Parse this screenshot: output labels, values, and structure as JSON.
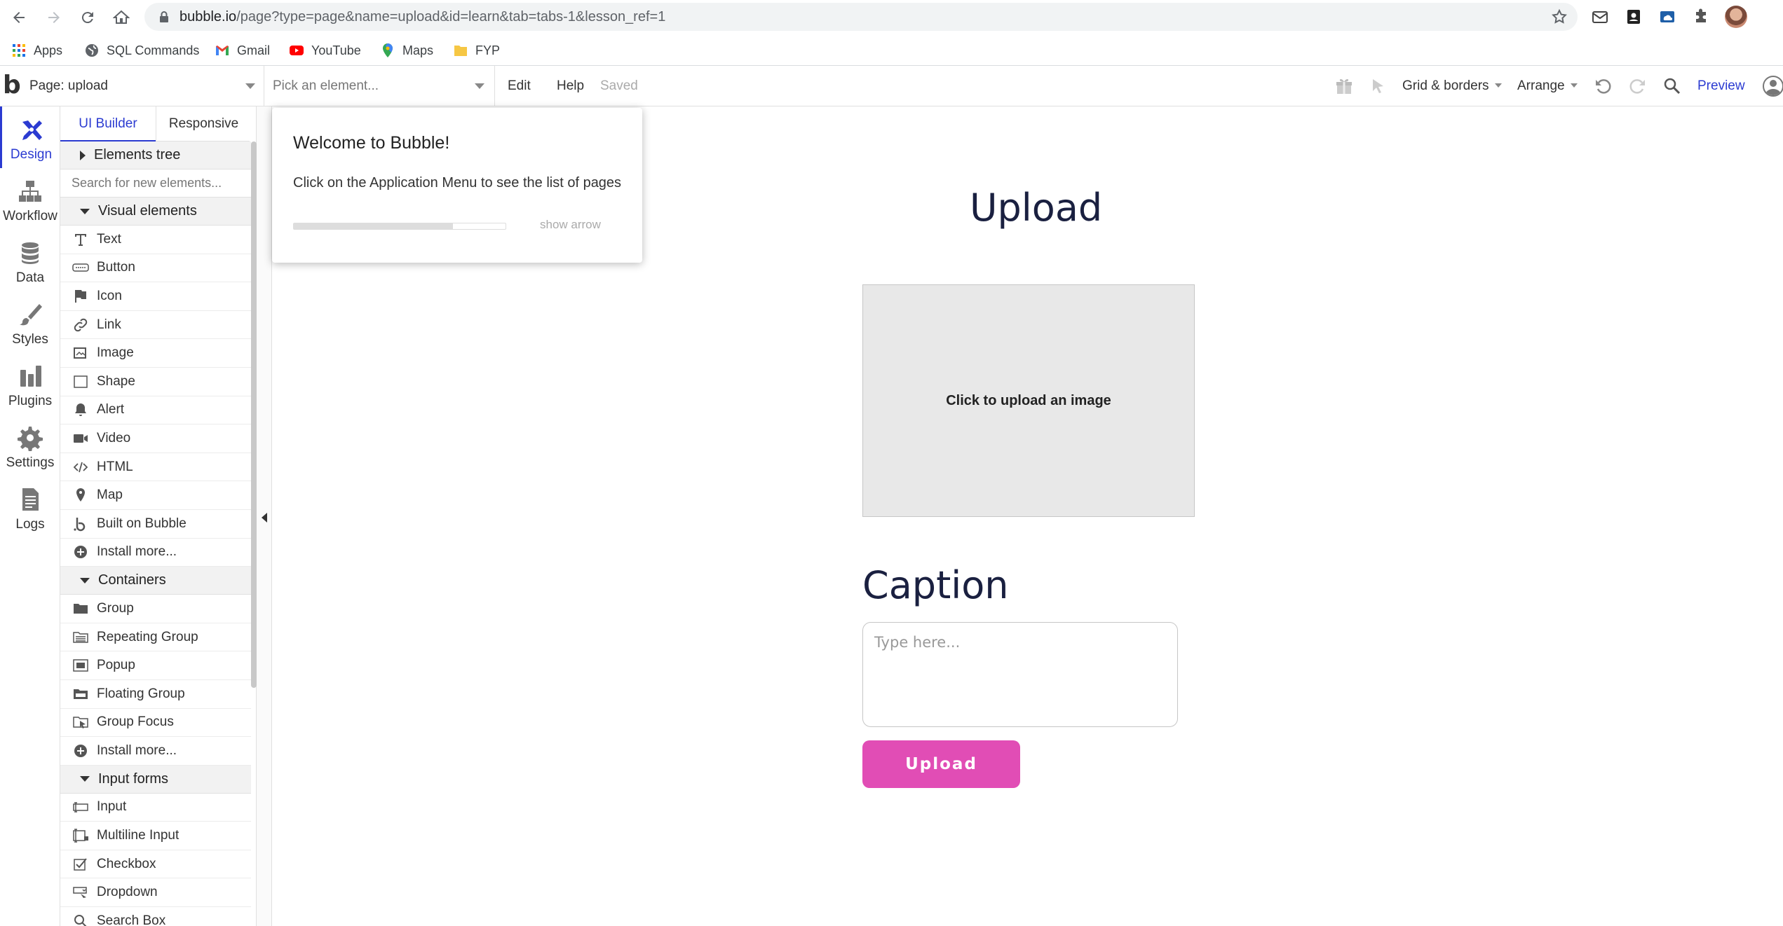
{
  "browser": {
    "url_host": "bubble.io",
    "url_path": "/page?type=page&name=upload&id=learn&tab=tabs-1&lesson_ref=1",
    "bookmarks": [
      {
        "label": "Apps",
        "icon": "apps-grid-icon"
      },
      {
        "label": "SQL Commands",
        "icon": "globe-icon"
      },
      {
        "label": "Gmail",
        "icon": "gmail-icon"
      },
      {
        "label": "YouTube",
        "icon": "youtube-icon"
      },
      {
        "label": "Maps",
        "icon": "maps-pin-icon"
      },
      {
        "label": "FYP",
        "icon": "folder-icon"
      }
    ]
  },
  "topbar": {
    "page_label": "Page: upload",
    "element_placeholder": "Pick an element...",
    "edit": "Edit",
    "help": "Help",
    "saved": "Saved",
    "grid_borders": "Grid & borders",
    "arrange": "Arrange",
    "preview": "Preview"
  },
  "rail": {
    "items": [
      {
        "label": "Design",
        "icon": "design-icon",
        "active": true
      },
      {
        "label": "Workflow",
        "icon": "workflow-icon"
      },
      {
        "label": "Data",
        "icon": "database-icon"
      },
      {
        "label": "Styles",
        "icon": "brush-icon"
      },
      {
        "label": "Plugins",
        "icon": "plugins-icon"
      },
      {
        "label": "Settings",
        "icon": "gear-icon"
      },
      {
        "label": "Logs",
        "icon": "logs-icon"
      }
    ]
  },
  "palette": {
    "tabs": [
      "UI Builder",
      "Responsive"
    ],
    "elements_tree": "Elements tree",
    "search_placeholder": "Search for new elements...",
    "visual_header": "Visual elements",
    "visual": [
      "Text",
      "Button",
      "Icon",
      "Link",
      "Image",
      "Shape",
      "Alert",
      "Video",
      "HTML",
      "Map",
      "Built on Bubble",
      "Install more..."
    ],
    "containers_header": "Containers",
    "containers": [
      "Group",
      "Repeating Group",
      "Popup",
      "Floating Group",
      "Group Focus",
      "Install more..."
    ],
    "inputs_header": "Input forms",
    "inputs": [
      "Input",
      "Multiline Input",
      "Checkbox",
      "Dropdown",
      "Search Box"
    ]
  },
  "canvas": {
    "title": "Upload",
    "upload_box": "Click to upload an image",
    "caption_label": "Caption",
    "caption_placeholder": "Type here...",
    "upload_button": "Upload"
  },
  "welcome": {
    "title": "Welcome to Bubble!",
    "body": "Click on the Application Menu to see the list of pages",
    "progress": 0.75,
    "show_arrow": "show arrow"
  },
  "colors": {
    "accent_blue": "#2b3bd1",
    "button_pink": "#e14db5",
    "heading_navy": "#1a2040"
  }
}
